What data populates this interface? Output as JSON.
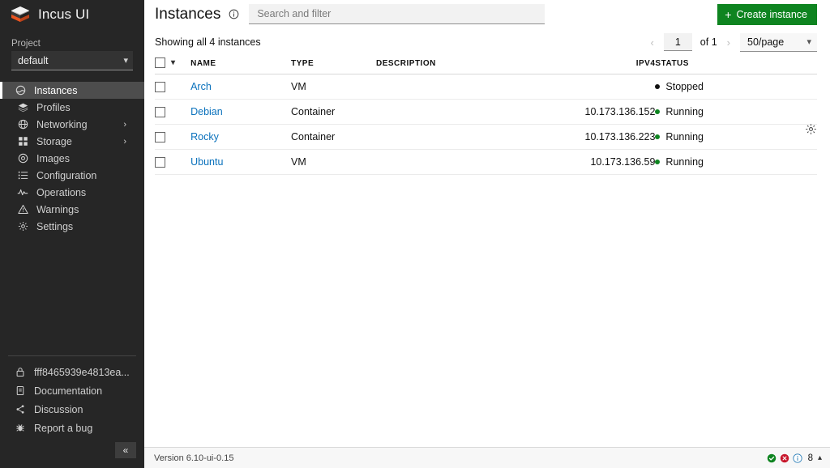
{
  "sidebar": {
    "logo_text": "Incus UI",
    "project": {
      "label": "Project",
      "value": "default"
    },
    "items": [
      {
        "label": "Instances",
        "icon": "instances-icon",
        "active": true,
        "expandable": false
      },
      {
        "label": "Profiles",
        "icon": "profiles-icon",
        "active": false,
        "expandable": false
      },
      {
        "label": "Networking",
        "icon": "networking-icon",
        "active": false,
        "expandable": true
      },
      {
        "label": "Storage",
        "icon": "storage-icon",
        "active": false,
        "expandable": true
      },
      {
        "label": "Images",
        "icon": "images-icon",
        "active": false,
        "expandable": false
      },
      {
        "label": "Configuration",
        "icon": "configuration-icon",
        "active": false,
        "expandable": false
      },
      {
        "label": "Operations",
        "icon": "operations-icon",
        "active": false,
        "expandable": false
      },
      {
        "label": "Warnings",
        "icon": "warnings-icon",
        "active": false,
        "expandable": false
      },
      {
        "label": "Settings",
        "icon": "settings-icon",
        "active": false,
        "expandable": false
      }
    ],
    "bottom_items": [
      {
        "label": "fff8465939e4813ea...",
        "icon": "lock-icon"
      },
      {
        "label": "Documentation",
        "icon": "document-icon"
      },
      {
        "label": "Discussion",
        "icon": "share-icon"
      },
      {
        "label": "Report a bug",
        "icon": "bug-icon"
      }
    ],
    "collapse_label": "«"
  },
  "header": {
    "title": "Instances",
    "info_icon": "info-icon",
    "search_placeholder": "Search and filter",
    "search_value": "",
    "create_button": "Create instance",
    "create_icon": "plus-icon"
  },
  "toolbar": {
    "showing_text": "Showing all 4 instances",
    "pagination": {
      "prev_icon": "chevron-left-icon",
      "page_value": "1",
      "of_label": "of 1",
      "next_icon": "chevron-right-icon",
      "per_page": "50/page"
    },
    "settings_icon": "gear-icon"
  },
  "table": {
    "columns": [
      "NAME",
      "TYPE",
      "DESCRIPTION",
      "IPV4",
      "STATUS"
    ],
    "rows": [
      {
        "name": "Arch",
        "type": "VM",
        "description": "",
        "ipv4": "",
        "status": "Stopped",
        "status_color": "#111111"
      },
      {
        "name": "Debian",
        "type": "Container",
        "description": "",
        "ipv4": "10.173.136.152",
        "status": "Running",
        "status_color": "#0e8420"
      },
      {
        "name": "Rocky",
        "type": "Container",
        "description": "",
        "ipv4": "10.173.136.223",
        "status": "Running",
        "status_color": "#0e8420"
      },
      {
        "name": "Ubuntu",
        "type": "VM",
        "description": "",
        "ipv4": "10.173.136.59",
        "status": "Running",
        "status_color": "#0e8420"
      }
    ]
  },
  "statusbar": {
    "version": "Version 6.10-ui-0.15",
    "success_icon": "check-circle-icon",
    "error_icon": "error-circle-icon",
    "info_icon": "info-circle-icon",
    "count": "8",
    "caret_icon": "chevron-up-icon"
  },
  "colors": {
    "sidebar_bg": "#262626",
    "accent_green": "#0e8420",
    "link_blue": "#0a71bc",
    "error_red": "#c7162b"
  }
}
